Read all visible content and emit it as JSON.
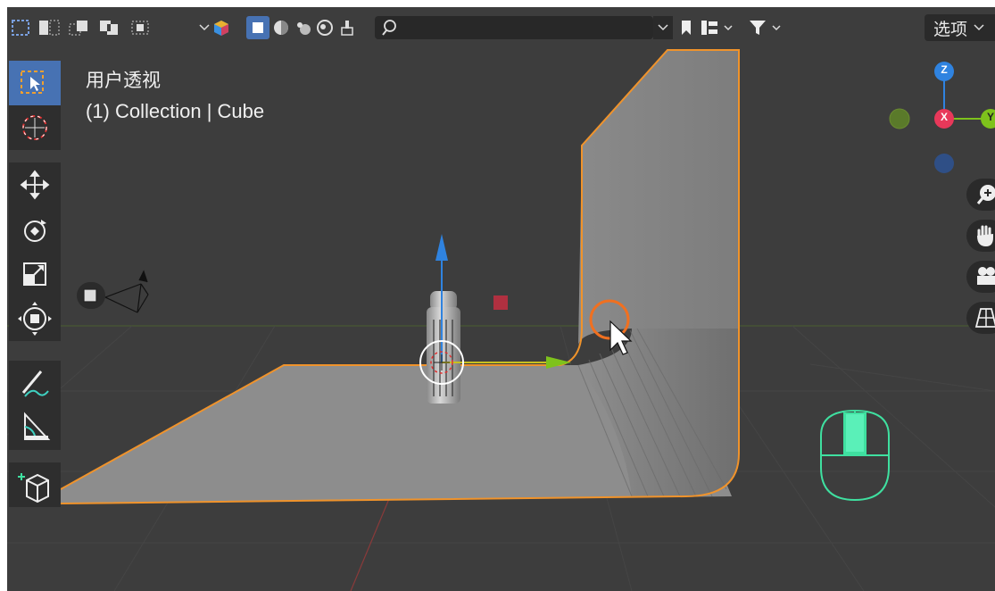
{
  "viewport": {
    "title": "用户透视",
    "subtitle": "(1) Collection | Cube"
  },
  "header": {
    "search": {
      "value": "",
      "placeholder": ""
    },
    "options_label": "选项"
  },
  "gizmo": {
    "z_label": "Z",
    "x_label": "X",
    "y_label": "Y"
  },
  "toolbar": {
    "tools": [
      {
        "name": "select-box",
        "active": true
      },
      {
        "name": "cursor"
      },
      {
        "name": "move"
      },
      {
        "name": "rotate"
      },
      {
        "name": "scale"
      },
      {
        "name": "transform"
      },
      {
        "name": "annotate"
      },
      {
        "name": "measure"
      },
      {
        "name": "add-cube"
      }
    ]
  },
  "colors": {
    "viewport_bg": "#3d3d3d",
    "toolbar_bg": "#2e2e2e",
    "active_tool": "#4772b3",
    "selection_outline": "#f0932b",
    "axis_x": "#e8385a",
    "axis_y": "#7ec21c",
    "axis_z": "#2f83e0",
    "mouse_indicator": "#3fe0a0"
  }
}
